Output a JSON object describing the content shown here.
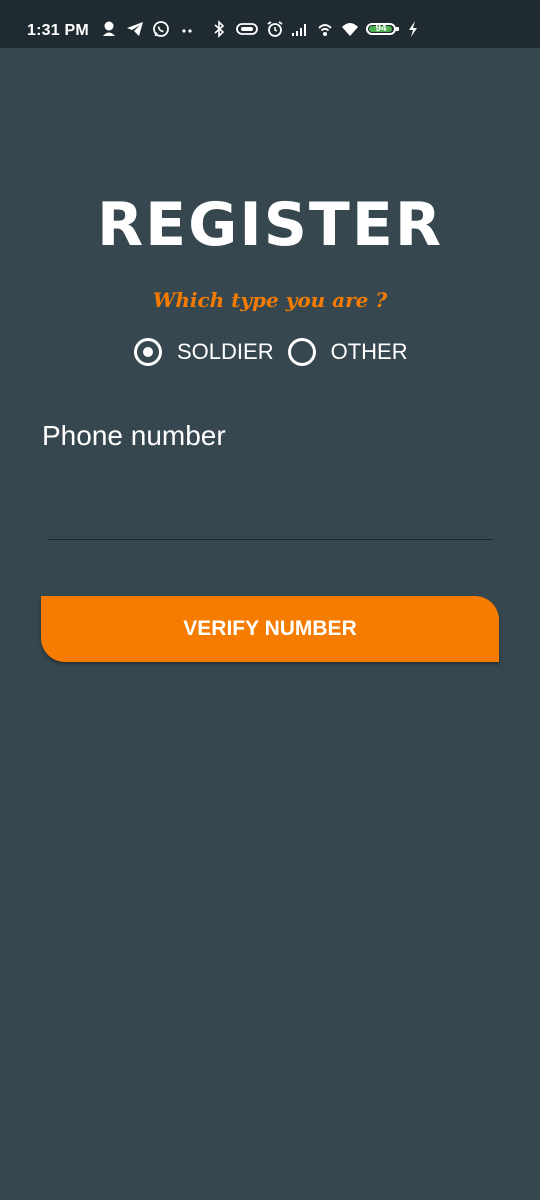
{
  "status_bar": {
    "time": "1:31 PM",
    "battery_level": "94",
    "battery_percent": 94,
    "icons_left": [
      "user-icon",
      "telegram-icon",
      "whatsapp-icon",
      "more-dots-icon"
    ],
    "icons_right": [
      "bluetooth-icon",
      "vibrate-icon",
      "alarm-icon",
      "signal-icon",
      "hotspot-icon",
      "wifi-icon",
      "battery-icon",
      "charging-icon"
    ]
  },
  "register": {
    "title": "REGISTER",
    "subtitle": "Which type you are ?",
    "options": [
      {
        "label": "SOLDIER",
        "selected": true
      },
      {
        "label": "OTHER",
        "selected": false
      }
    ],
    "phone_label": "Phone number",
    "phone_value": "",
    "button_label": "VERIFY NUMBER"
  },
  "colors": {
    "background": "#37474f",
    "status_bar": "#1f2b30",
    "accent": "#f57c00",
    "battery": "#4caf50",
    "text": "#ffffff"
  }
}
